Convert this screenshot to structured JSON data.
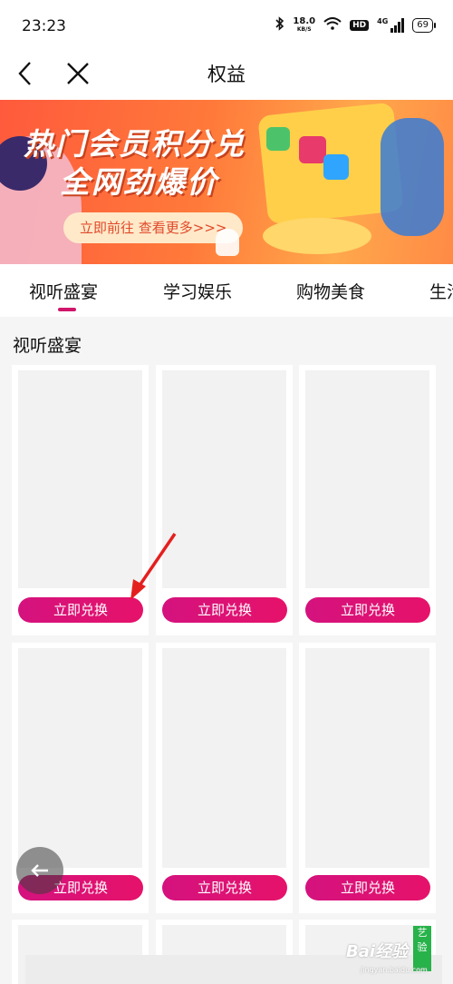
{
  "status_bar": {
    "time": "23:23",
    "speed_value": "18.0",
    "speed_unit": "KB/S",
    "hd_label": "HD",
    "network": "4G",
    "battery": "69"
  },
  "header": {
    "title": "权益"
  },
  "banner": {
    "title_line1": "热门会员积分兑",
    "title_line2": "全网劲爆价",
    "cta": "立即前往 查看更多>>>"
  },
  "tabs": [
    {
      "label": "视听盛宴",
      "active": true
    },
    {
      "label": "学习娱乐",
      "active": false
    },
    {
      "label": "购物美食",
      "active": false
    },
    {
      "label": "生活",
      "active": false
    }
  ],
  "section": {
    "title": "视听盛宴"
  },
  "cards": {
    "redeem_label": "立即兑换"
  },
  "side_tag": "艺验",
  "watermark": {
    "main": "Bai经验",
    "sub": "jingyan.baidu.com"
  },
  "colors": {
    "accent": "#d0166b",
    "button_gradient_start": "#d4127e",
    "button_gradient_end": "#e6126a"
  }
}
